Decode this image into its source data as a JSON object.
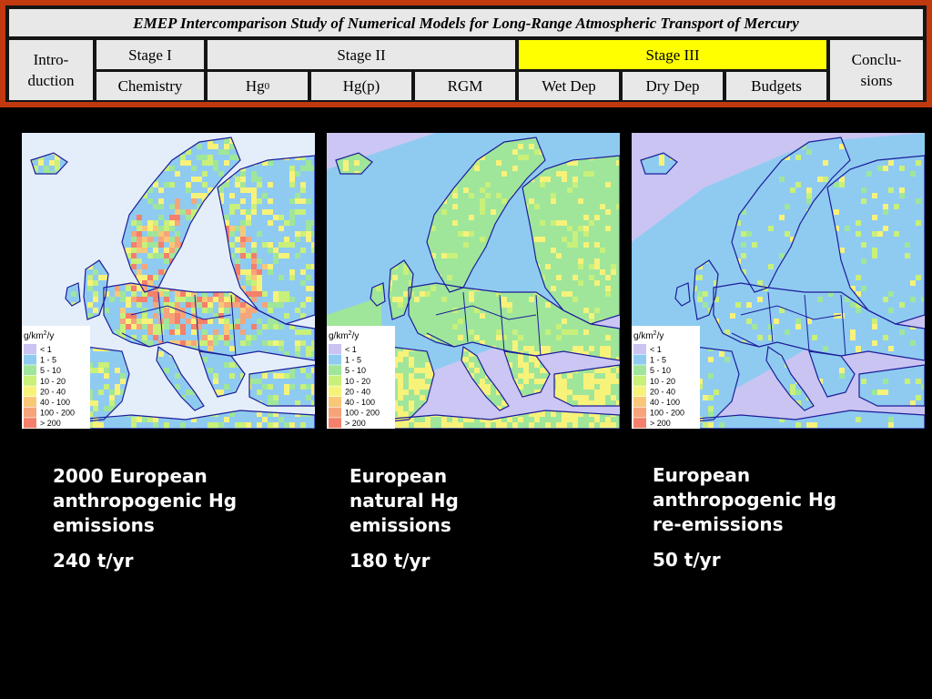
{
  "header": {
    "title": "EMEP Intercomparison Study of Numerical Models for Long-Range Atmospheric Transport of Mercury",
    "nav": {
      "introduction": "Intro-\nduction",
      "stage1": "Stage I",
      "stage2": "Stage II",
      "stage3": "Stage III",
      "conclusions": "Conclu-\nsions",
      "chemistry": "Chemistry",
      "hg0_base": "Hg",
      "hg0_sup": "0",
      "hgp": "Hg(p)",
      "rgm": "RGM",
      "wetdep": "Wet Dep",
      "drydep": "Dry Dep",
      "budgets": "Budgets"
    }
  },
  "legend": {
    "unit_base": "g/km",
    "unit_sup": "2",
    "unit_suffix": "/y",
    "items": [
      "< 1",
      "1 - 5",
      "5 - 10",
      "10 - 20",
      "20 - 40",
      "40 - 100",
      "100 - 200",
      "> 200"
    ],
    "colors": [
      "#c9c4f2",
      "#8fcbf0",
      "#9fe69a",
      "#c8f07a",
      "#f7f27a",
      "#f8c878",
      "#f6a47a",
      "#f47f6b"
    ]
  },
  "maps": [
    {
      "caption_lines": [
        "2000 European",
        "anthropogenic Hg",
        "emissions"
      ],
      "amount": "240 t/yr"
    },
    {
      "caption_lines": [
        "European",
        "natural Hg",
        "emissions"
      ],
      "amount": "180 t/yr"
    },
    {
      "caption_lines": [
        "European",
        "anthropogenic Hg",
        "re-emissions"
      ],
      "amount": "50 t/yr"
    }
  ]
}
